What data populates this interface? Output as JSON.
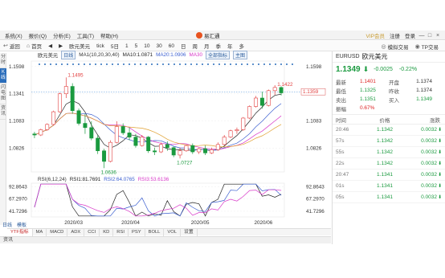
{
  "window": {
    "app_title": "易汇通",
    "menu": [
      "系统(X)",
      "报价(Q)",
      "分析(E)",
      "工具(T)",
      "帮助(H)"
    ],
    "vip_label": "VIP会员",
    "register_label": "注册",
    "login_label": "登录",
    "min_label": "—",
    "max_label": "□",
    "close_label": "×"
  },
  "toolbar": {
    "back_label": "返回",
    "home_label": "首页",
    "prev_label": "◀",
    "next_label": "▶",
    "symbol_label": "欧元美元",
    "periods": [
      "tick",
      "5日",
      "1",
      "5",
      "10",
      "30",
      "60",
      "日",
      "周",
      "月",
      "季",
      "年",
      "多"
    ],
    "sim_trade_label": "模拟交易",
    "trade_label": "TP交易"
  },
  "left_tabs": [
    "分时",
    "K线",
    "闪电图",
    "资讯"
  ],
  "chart": {
    "legend": {
      "name": "欧元美元",
      "tag": "日线",
      "ma_title": "MA1(10,20,30,40)",
      "ma10": "MA10:1.0871",
      "ma20": "MA20:1.0906",
      "ma30": "MA30",
      "indicator_btn": "全部指标",
      "main_btn": "主图"
    },
    "rsi_legend": {
      "title": "RSI(6,12,24)",
      "rsi1": "RSI1:81.7691",
      "rsi2": "RSI2:64.0765",
      "rsi3": "RSI3:53.6136"
    },
    "price_labels": [
      "1.1598",
      "1.1341",
      "1.1083",
      "1.0826"
    ],
    "current_price_tag": "1.1359",
    "high_label": "1.1495",
    "recent_high_label": "1.1422",
    "low_label": "1.0636",
    "mid_low_label": "1.0727",
    "rsi_labels": [
      "92.8643",
      "67.2970",
      "41.7296"
    ],
    "x_labels": [
      "2020/03",
      "2020/04",
      "2020/05",
      "2020/06"
    ],
    "colors": {
      "up": "#e24040",
      "down": "#1a9a3f",
      "ma10": "#222222",
      "ma20": "#3b5fd0",
      "ma30": "#d838c8",
      "ma40": "#e0a030"
    }
  },
  "indicator_tabs": {
    "active": "YTF指标",
    "items": [
      "YTF指标",
      "MA",
      "MACD",
      "ADX",
      "CCI",
      "KD",
      "RSI",
      "PSY",
      "BOLL",
      "VOL",
      "设置"
    ],
    "sub": [
      "日线",
      "模板"
    ]
  },
  "status": {
    "left_label": "资讯"
  },
  "quote": {
    "code": "EURUSD",
    "name": "欧元美元",
    "price": "1.1349",
    "arrow": "⬇",
    "change": "-0.0025",
    "change_pct": "-0.22%",
    "stats": [
      {
        "label": "最新",
        "value": "1.1401",
        "label2": "开盘",
        "value2": "1.1374"
      },
      {
        "label": "最低",
        "value": "1.1325",
        "label2": "昨收",
        "value2": "1.1374"
      },
      {
        "label": "卖出",
        "value": "1.1351",
        "label2": "买入",
        "value2": "1.1349"
      },
      {
        "label": "振幅",
        "value": "0.67%",
        "label2": "",
        "value2": ""
      }
    ],
    "tick_header": {
      "time": "时间",
      "price": "价格",
      "chg": "涨跌"
    },
    "ticks": [
      {
        "time": "20:46",
        "price": "1.1342",
        "chg": "0.0032",
        "arrow": "⬇"
      },
      {
        "time": "57s",
        "price": "1.1342",
        "chg": "0.0032",
        "arrow": "⬇"
      },
      {
        "time": "55s",
        "price": "1.1342",
        "chg": "0.0032",
        "arrow": "⬇"
      },
      {
        "time": "22s",
        "price": "1.1342",
        "chg": "0.0032",
        "arrow": "⬇"
      },
      {
        "time": "20:47",
        "price": "1.1341",
        "chg": "0.0032",
        "arrow": "⬇"
      },
      {
        "time": "01s",
        "price": "1.1341",
        "chg": "0.0032",
        "arrow": "⬇"
      },
      {
        "time": "05s",
        "price": "1.1341",
        "chg": "0.0032",
        "arrow": "⬇"
      }
    ]
  },
  "candles": [
    [
      1.096,
      1.098,
      1.092,
      1.095
    ],
    [
      1.095,
      1.101,
      1.094,
      1.1
    ],
    [
      1.1,
      1.106,
      1.099,
      1.105
    ],
    [
      1.105,
      1.118,
      1.104,
      1.117
    ],
    [
      1.117,
      1.135,
      1.116,
      1.134
    ],
    [
      1.134,
      1.1495,
      1.13,
      1.141
    ],
    [
      1.141,
      1.144,
      1.115,
      1.118
    ],
    [
      1.118,
      1.12,
      1.104,
      1.106
    ],
    [
      1.106,
      1.115,
      1.096,
      1.102
    ],
    [
      1.102,
      1.108,
      1.09,
      1.092
    ],
    [
      1.092,
      1.095,
      1.077,
      1.08
    ],
    [
      1.08,
      1.082,
      1.0636,
      1.07
    ],
    [
      1.07,
      1.09,
      1.069,
      1.088
    ],
    [
      1.088,
      1.108,
      1.087,
      1.103
    ],
    [
      1.103,
      1.106,
      1.095,
      1.097
    ],
    [
      1.097,
      1.102,
      1.09,
      1.093
    ],
    [
      1.093,
      1.096,
      1.083,
      1.085
    ],
    [
      1.085,
      1.095,
      1.084,
      1.093
    ],
    [
      1.093,
      1.094,
      1.078,
      1.08
    ],
    [
      1.08,
      1.083,
      1.076,
      1.079
    ],
    [
      1.079,
      1.088,
      1.078,
      1.086
    ],
    [
      1.086,
      1.089,
      1.08,
      1.083
    ],
    [
      1.083,
      1.084,
      1.074,
      1.076
    ],
    [
      1.076,
      1.083,
      1.0727,
      1.08
    ],
    [
      1.08,
      1.086,
      1.079,
      1.085
    ],
    [
      1.085,
      1.087,
      1.077,
      1.079
    ],
    [
      1.079,
      1.083,
      1.077,
      1.082
    ],
    [
      1.082,
      1.085,
      1.076,
      1.078
    ],
    [
      1.078,
      1.083,
      1.077,
      1.081
    ],
    [
      1.081,
      1.088,
      1.08,
      1.086
    ],
    [
      1.086,
      1.095,
      1.085,
      1.093
    ],
    [
      1.093,
      1.1,
      1.092,
      1.099
    ],
    [
      1.099,
      1.102,
      1.096,
      1.1
    ],
    [
      1.1,
      1.112,
      1.099,
      1.111
    ],
    [
      1.111,
      1.123,
      1.11,
      1.122
    ],
    [
      1.122,
      1.132,
      1.121,
      1.13
    ],
    [
      1.13,
      1.136,
      1.12,
      1.123
    ],
    [
      1.123,
      1.138,
      1.122,
      1.137
    ],
    [
      1.137,
      1.1422,
      1.133,
      1.14
    ],
    [
      1.14,
      1.141,
      1.1325,
      1.1349
    ]
  ]
}
